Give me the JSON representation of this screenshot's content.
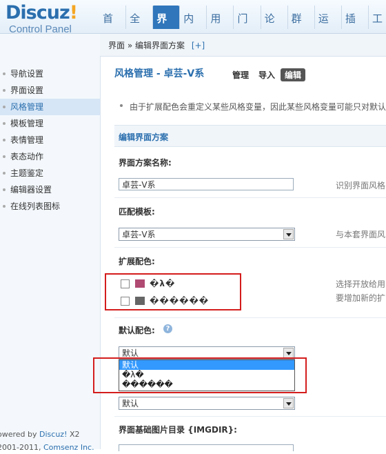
{
  "header": {
    "logo_text": "Discuz",
    "logo_exclaim": "!",
    "logo_sub": "Control Panel",
    "nav": [
      {
        "label": "首页"
      },
      {
        "label": "全局"
      },
      {
        "label": "界面",
        "active": true
      },
      {
        "label": "内容"
      },
      {
        "label": "用户"
      },
      {
        "label": "门户"
      },
      {
        "label": "论坛"
      },
      {
        "label": "群组"
      },
      {
        "label": "运营"
      },
      {
        "label": "插件"
      },
      {
        "label": "工"
      }
    ]
  },
  "sidebar": {
    "items": [
      {
        "label": "导航设置"
      },
      {
        "label": "界面设置"
      },
      {
        "label": "风格管理",
        "active": true
      },
      {
        "label": "模板管理"
      },
      {
        "label": "表情管理"
      },
      {
        "label": "表态动作"
      },
      {
        "label": "主题鉴定"
      },
      {
        "label": "编辑器设置"
      },
      {
        "label": "在线列表图标"
      }
    ],
    "footer_line1": "owered by ",
    "footer_brand": "Discuz!",
    "footer_version": " X2",
    "footer_line2": "2001-2011, ",
    "footer_company": "Comsenz Inc."
  },
  "breadcrumb": {
    "path": "界面 » 编辑界面方案",
    "plus": "[+]"
  },
  "page": {
    "title": "风格管理 - 卓芸-V系",
    "tabs": [
      {
        "label": "管理"
      },
      {
        "label": "导入"
      },
      {
        "label": "编辑",
        "active": true
      }
    ],
    "tip": "由于扩展配色会重定义某些风格变量，因此某些风格变量可能只对默认"
  },
  "form": {
    "section_title": "编辑界面方案",
    "name_label": "界面方案名称:",
    "name_value": "卓芸-V系",
    "name_hint": "识别界面风格",
    "template_label": "匹配模板:",
    "template_value": "卓芸-V系",
    "template_hint": "与本套界面风",
    "ext_label": "扩展配色:",
    "ext_colors": [
      {
        "label": "�λ�",
        "color": "#b04a72"
      },
      {
        "label": "������",
        "color": "#666666"
      }
    ],
    "ext_hint1": "选择开放给用",
    "ext_hint2": "要增加新的扩",
    "default_label": "默认配色:",
    "help_glyph": "?",
    "default_value": "默认",
    "dropdown_options": [
      {
        "label": "默认",
        "selected": true
      },
      {
        "label": "�λ�"
      },
      {
        "label": "������"
      }
    ],
    "default_value2": "默认",
    "imgdir_label": "界面基础图片目录 {IMGDIR}:"
  },
  "colors": {
    "accent": "#2b6fae",
    "nav_active": "#2f76bb",
    "highlight_box": "#d41c1c",
    "dropdown_selected": "#3399ff"
  }
}
